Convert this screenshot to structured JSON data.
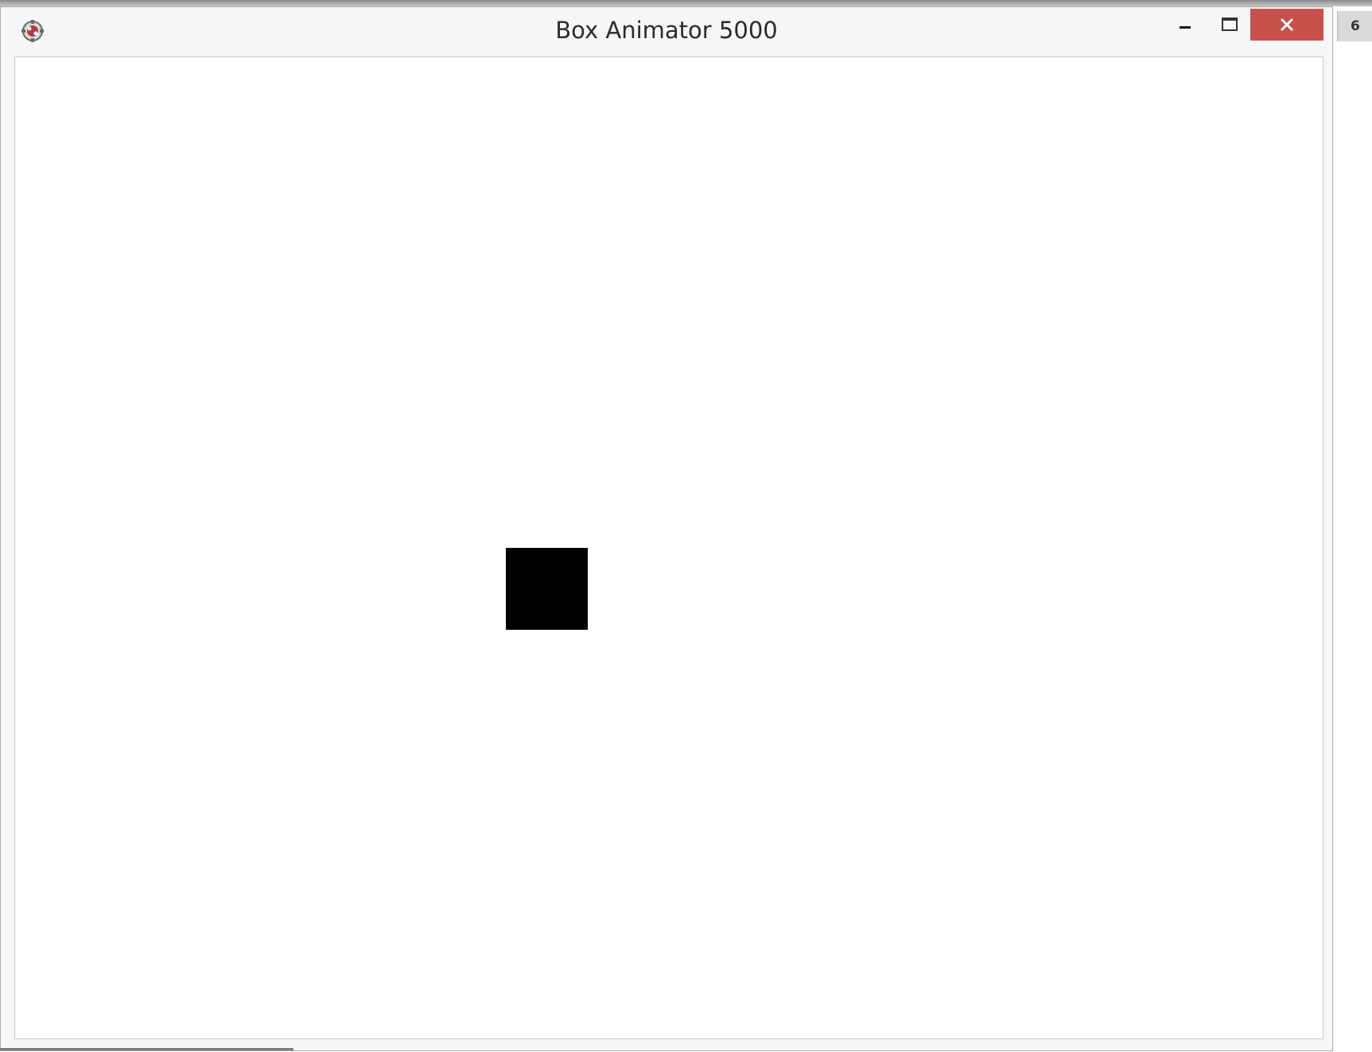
{
  "window": {
    "title": "Box Animator 5000",
    "close_color": "#c7504a"
  },
  "icons": {
    "app": "app-icon",
    "minimize": "minimize-icon",
    "maximize": "maximize-icon",
    "close": "close-icon"
  },
  "canvas": {
    "shape": "square",
    "fill": "#000000"
  },
  "side_tab": {
    "label": "6"
  }
}
